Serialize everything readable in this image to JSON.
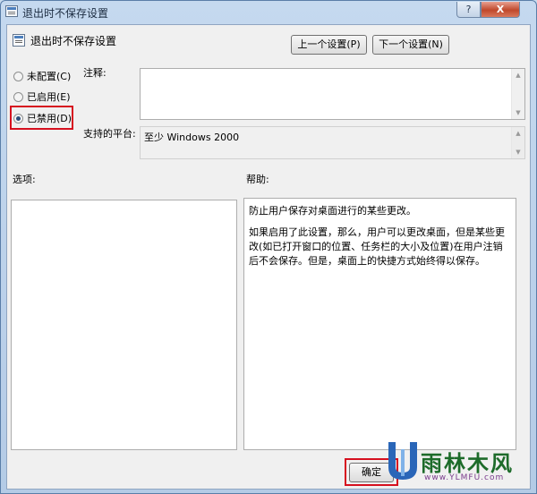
{
  "window": {
    "title": "退出时不保存设置",
    "help_glyph": "?",
    "close_glyph": "X"
  },
  "header": {
    "setting_name": "退出时不保存设置",
    "prev_button": "上一个设置(P)",
    "next_button": "下一个设置(N)"
  },
  "radios": [
    {
      "label": "未配置(C)",
      "checked": false
    },
    {
      "label": "已启用(E)",
      "checked": false
    },
    {
      "label": "已禁用(D)",
      "checked": true
    }
  ],
  "comment": {
    "label": "注释:",
    "value": ""
  },
  "platform": {
    "label": "支持的平台:",
    "value": "至少 Windows 2000"
  },
  "options": {
    "label": "选项:"
  },
  "help": {
    "label": "帮助:",
    "paragraphs": [
      "防止用户保存对桌面进行的某些更改。",
      "如果启用了此设置，那么，用户可以更改桌面，但是某些更改(如已打开窗口的位置、任务栏的大小及位置)在用户注销后不会保存。但是，桌面上的快捷方式始终得以保存。"
    ]
  },
  "footer": {
    "ok_button": "确定"
  },
  "watermark": {
    "text": "雨林木风",
    "url": "www.YLMFU.com"
  },
  "colors": {
    "highlight": "#d6101f",
    "titlebar": "#c5d9ef"
  }
}
